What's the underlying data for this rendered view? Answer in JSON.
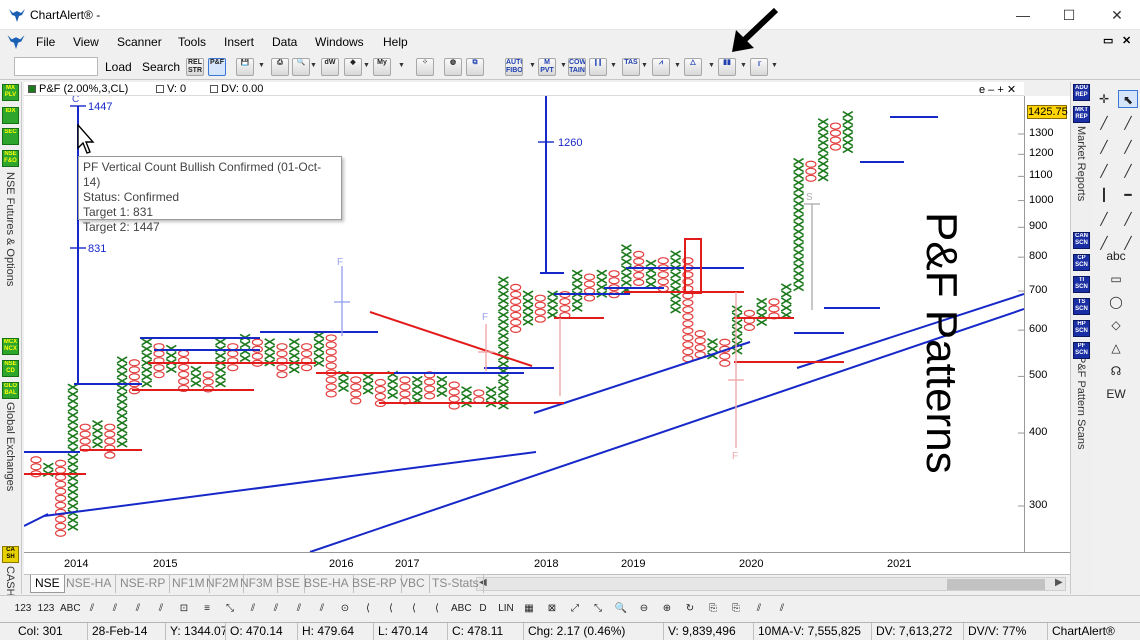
{
  "window": {
    "title": "ChartAlert® -",
    "minimize": "—",
    "maximize": "☐",
    "close": "✕"
  },
  "menu": {
    "items": [
      "File",
      "View",
      "Scanner",
      "Tools",
      "Insert",
      "Data",
      "Windows",
      "Help"
    ],
    "restore": "▭",
    "close": "✕"
  },
  "toolbar": {
    "search_value": "",
    "load_label": "Load",
    "search_label": "Search",
    "icons": [
      {
        "name": "rel-str",
        "text": "REL STR"
      },
      {
        "name": "pf-chart",
        "text": "P&F"
      },
      {
        "name": "save",
        "text": "💾"
      },
      {
        "name": "print",
        "text": "⎙"
      },
      {
        "name": "print-preview",
        "text": "🔍"
      },
      {
        "name": "dw",
        "text": "dW"
      },
      {
        "name": "highlight",
        "text": "◆"
      },
      {
        "name": "my",
        "text": "My"
      },
      {
        "name": "scatter",
        "text": "⁘"
      },
      {
        "name": "globe",
        "text": "◍"
      },
      {
        "name": "copy",
        "text": "⧉"
      },
      {
        "name": "auto-fibo",
        "text": "AUTO FIBO"
      },
      {
        "name": "m-pvt",
        "text": "M PVT"
      },
      {
        "name": "cow-tain",
        "text": "COW TAIN"
      },
      {
        "name": "candle",
        "text": "┃┃"
      },
      {
        "name": "tas",
        "text": "TAS"
      },
      {
        "name": "pattern",
        "text": "⩘"
      },
      {
        "name": "triangle",
        "text": "△"
      },
      {
        "name": "pf-bars",
        "text": "▮▮"
      },
      {
        "name": "steps",
        "text": "╓"
      }
    ]
  },
  "left_panel": {
    "buttons_top": [
      "MX PLV",
      "IDX",
      "SEC",
      "NSE F&O"
    ],
    "label_top": "NSE Futures & Options",
    "buttons_bottom": [
      "MCX NCX",
      "NSE CD",
      "GLO BAL"
    ],
    "label_bottom": "Global Exchanges",
    "button_cash": "CA SH",
    "label_cash": "CASH"
  },
  "chart_header": {
    "name": "P&F (2.00%,3,CL)",
    "v": "V: 0",
    "dv": "DV: 0.00",
    "controls": "e – + ✕"
  },
  "chart": {
    "y_ticks": [
      "1300",
      "1200",
      "1100",
      "1000",
      "900",
      "800",
      "700",
      "600",
      "500",
      "400",
      "300"
    ],
    "last_price": "1425.75",
    "x_ticks": [
      "2014",
      "2015",
      "2016",
      "2017",
      "2018",
      "2019",
      "2020",
      "2021"
    ],
    "annotations": {
      "c": "C",
      "p1447": "1447",
      "p831": "831",
      "p1260": "1260",
      "f1": "F",
      "f2": "F",
      "f3": "F",
      "s": "S"
    },
    "tooltip": {
      "title": "PF Vertical Count Bullish Confirmed (01-Oct-14)",
      "status": "Status: Confirmed",
      "target1": "Target 1: 831",
      "target2": "Target 2: 1447"
    },
    "watermark": "P&F Patterns"
  },
  "chart_data": {
    "type": "point-and-figure",
    "box_size": "2.00%",
    "reversal": 3,
    "price_field": "CL",
    "y_scale": "log",
    "y_ticks": [
      300,
      400,
      500,
      600,
      700,
      800,
      900,
      1000,
      1100,
      1200,
      1300
    ],
    "x_ticks": [
      "2014",
      "2015",
      "2016",
      "2017",
      "2018",
      "2019",
      "2020",
      "2021"
    ],
    "last_price": 1425.75,
    "columns": [
      {
        "type": "O",
        "from": 340,
        "to": 365
      },
      {
        "type": "X",
        "from": 340,
        "to": 355
      },
      {
        "type": "O",
        "from": 270,
        "to": 360
      },
      {
        "type": "X",
        "from": 275,
        "to": 485
      },
      {
        "type": "O",
        "from": 380,
        "to": 415
      },
      {
        "type": "X",
        "from": 385,
        "to": 420
      },
      {
        "type": "O",
        "from": 370,
        "to": 415
      },
      {
        "type": "X",
        "from": 380,
        "to": 540
      },
      {
        "type": "O",
        "from": 475,
        "to": 535
      },
      {
        "type": "X",
        "from": 485,
        "to": 580
      },
      {
        "type": "O",
        "from": 510,
        "to": 570
      },
      {
        "type": "X",
        "from": 520,
        "to": 565
      },
      {
        "type": "O",
        "from": 475,
        "to": 555
      },
      {
        "type": "X",
        "from": 485,
        "to": 520
      },
      {
        "type": "O",
        "from": 470,
        "to": 510
      },
      {
        "type": "X",
        "from": 480,
        "to": 580
      },
      {
        "type": "O",
        "from": 520,
        "to": 570
      },
      {
        "type": "X",
        "from": 530,
        "to": 590
      },
      {
        "type": "O",
        "from": 525,
        "to": 580
      },
      {
        "type": "X",
        "from": 530,
        "to": 580
      },
      {
        "type": "O",
        "from": 500,
        "to": 570
      },
      {
        "type": "X",
        "from": 510,
        "to": 580
      },
      {
        "type": "O",
        "from": 520,
        "to": 570
      },
      {
        "type": "X",
        "from": 525,
        "to": 595
      },
      {
        "type": "O",
        "from": 465,
        "to": 590
      },
      {
        "type": "X",
        "from": 470,
        "to": 510
      },
      {
        "type": "O",
        "from": 460,
        "to": 500
      },
      {
        "type": "X",
        "from": 470,
        "to": 505
      },
      {
        "type": "O",
        "from": 455,
        "to": 495
      },
      {
        "type": "X",
        "from": 465,
        "to": 510
      },
      {
        "type": "O",
        "from": 455,
        "to": 500
      },
      {
        "type": "X",
        "from": 460,
        "to": 500
      },
      {
        "type": "O",
        "from": 460,
        "to": 510
      },
      {
        "type": "X",
        "from": 470,
        "to": 500
      },
      {
        "type": "O",
        "from": 450,
        "to": 490
      },
      {
        "type": "X",
        "from": 450,
        "to": 480
      },
      {
        "type": "O",
        "from": 450,
        "to": 475
      },
      {
        "type": "X",
        "from": 445,
        "to": 480
      },
      {
        "type": "X",
        "from": 445,
        "to": 740
      },
      {
        "type": "O",
        "from": 610,
        "to": 720
      },
      {
        "type": "X",
        "from": 625,
        "to": 700
      },
      {
        "type": "O",
        "from": 620,
        "to": 690
      },
      {
        "type": "X",
        "from": 630,
        "to": 700
      },
      {
        "type": "O",
        "from": 640,
        "to": 700
      },
      {
        "type": "X",
        "from": 650,
        "to": 760
      },
      {
        "type": "O",
        "from": 680,
        "to": 750
      },
      {
        "type": "X",
        "from": 690,
        "to": 760
      },
      {
        "type": "O",
        "from": 690,
        "to": 760
      },
      {
        "type": "X",
        "from": 700,
        "to": 840
      },
      {
        "type": "O",
        "from": 720,
        "to": 820
      },
      {
        "type": "X",
        "from": 720,
        "to": 790
      },
      {
        "type": "O",
        "from": 700,
        "to": 800
      },
      {
        "type": "X",
        "from": 640,
        "to": 820
      },
      {
        "type": "O",
        "from": 540,
        "to": 800
      },
      {
        "type": "O",
        "from": 540,
        "to": 600
      },
      {
        "type": "X",
        "from": 540,
        "to": 580
      },
      {
        "type": "O",
        "from": 530,
        "to": 580
      },
      {
        "type": "X",
        "from": 545,
        "to": 660
      },
      {
        "type": "O",
        "from": 600,
        "to": 650
      },
      {
        "type": "X",
        "from": 610,
        "to": 680
      },
      {
        "type": "O",
        "from": 630,
        "to": 680
      },
      {
        "type": "X",
        "from": 640,
        "to": 720
      },
      {
        "type": "X",
        "from": 700,
        "to": 1180
      },
      {
        "type": "O",
        "from": 1080,
        "to": 1170
      },
      {
        "type": "X",
        "from": 1090,
        "to": 1380
      },
      {
        "type": "O",
        "from": 1220,
        "to": 1360
      },
      {
        "type": "X",
        "from": 1230,
        "to": 1420
      }
    ],
    "vertical_counts": [
      {
        "label": "C",
        "base": 485,
        "target1": 831,
        "target2": 1447
      },
      {
        "label": "",
        "base": 740,
        "target1": 1260
      }
    ]
  },
  "tabs": [
    "NSE",
    "NSE-HA",
    "NSE-RP",
    "NF1M",
    "NF2M",
    "NF3M",
    "BSE",
    "BSE-HA",
    "BSE-RP",
    "VBC",
    "TS-Stats"
  ],
  "right_panel": {
    "buttons_top": [
      "ADU REP",
      "MKT REP"
    ],
    "label_top": "Market Reports",
    "buttons_mid": [
      "CAN SCN",
      "CP SCN",
      "TI SCN",
      "TS SCN",
      "HP SCN",
      "PF SCN"
    ],
    "label_mid": "P&F Pattern Scans"
  },
  "drawing_tools": [
    "✛",
    "⬉",
    "╱",
    "╱",
    "╱",
    "╱",
    "╱",
    "╱",
    "┃",
    "━",
    "╱",
    "╱",
    "╱",
    "╱",
    "abc",
    "▭",
    "◯",
    "◇",
    "△",
    "☊",
    "EW"
  ],
  "bottom_toolbar": [
    "123",
    "123",
    "ABC",
    "⫽",
    "⫽",
    "⫽",
    "⫽",
    "⊡",
    "≡",
    "⤡",
    "⫽",
    "⫽",
    "⫽",
    "⫽",
    "⊙",
    "⟨",
    "⟨",
    "⟨",
    "⟨",
    "ABC",
    "D",
    "LIN",
    "▦",
    "⊠",
    "⤢",
    "⤡",
    "🔍",
    "⊖",
    "⊕",
    "↻",
    "⎘",
    "⎘",
    "⫽",
    "⫽"
  ],
  "status": {
    "col": "Col: 301",
    "date": "28-Feb-14",
    "y": "Y: 1344.07",
    "o": "O: 470.14",
    "h": "H: 479.64",
    "l": "L: 470.14",
    "c": "C: 478.11",
    "chg": "Chg: 2.17 (0.46%)",
    "v": "V: 9,839,496",
    "ma": "10MA-V: 7,555,825",
    "dv": "DV: 7,613,272",
    "dvv": "DV/V: 77%",
    "brand": "ChartAlert®"
  },
  "colors": {
    "x_mark": "#1d7a1d",
    "o_mark": "#e24040",
    "blue_line": "#1728c9",
    "red_line": "#e21b1b"
  }
}
